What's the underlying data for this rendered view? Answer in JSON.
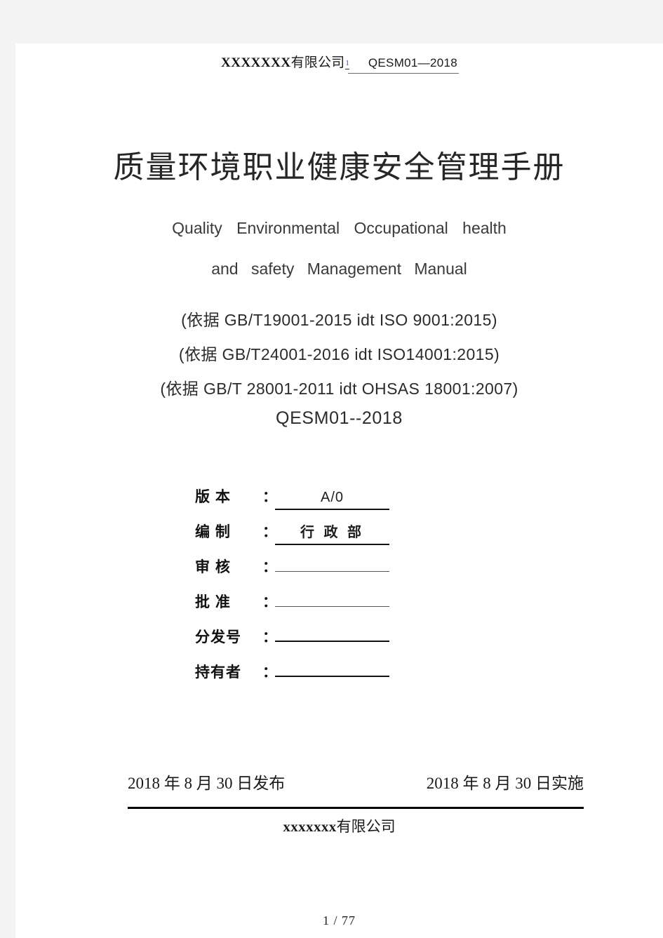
{
  "header": {
    "company_latin": "XXXXXXX",
    "company_cjk": "有限公司",
    "superscript": "1",
    "doc_code": "QESM01—2018"
  },
  "title": {
    "main": "质量环境职业健康安全管理手册",
    "subtitle_line1": "Quality  Environmental  Occupational  health",
    "subtitle_line2": "and  safety  Management  Manual"
  },
  "standards": [
    "(依据 GB/T19001-2015 idt ISO 9001:2015)",
    "(依据 GB/T24001-2016 idt ISO14001:2015)",
    "(依据 GB/T 28001-2011 idt OHSAS 18001:2007)"
  ],
  "document_code": "QESM01--2018",
  "form_fields": [
    {
      "label": "版  本",
      "colon": "：",
      "value": "A/0",
      "filled": true,
      "cjk": false
    },
    {
      "label": "编  制",
      "colon": "：",
      "value": "行 政 部",
      "filled": true,
      "cjk": true
    },
    {
      "label": "审  核",
      "colon": "：",
      "value": "",
      "filled": false,
      "cjk": false
    },
    {
      "label": "批  准",
      "colon": "：",
      "value": "",
      "filled": false,
      "cjk": false
    },
    {
      "label": "分发号",
      "colon": "：",
      "value": "",
      "filled": false,
      "cjk": false
    },
    {
      "label": "持有者",
      "colon": "：",
      "value": "",
      "filled": false,
      "cjk": false
    }
  ],
  "dates": {
    "publish": "2018 年 8 月 30 日发布",
    "implement": "2018 年 8 月 30 日实施"
  },
  "footer": {
    "company_latin": "xxxxxxx",
    "company_cjk": "有限公司",
    "page_number": "1 / 77"
  },
  "colors": {
    "page_background": "#ffffff",
    "canvas_background": "#f4f4f4",
    "text": "#1a1a1a",
    "rule": "#000000"
  }
}
